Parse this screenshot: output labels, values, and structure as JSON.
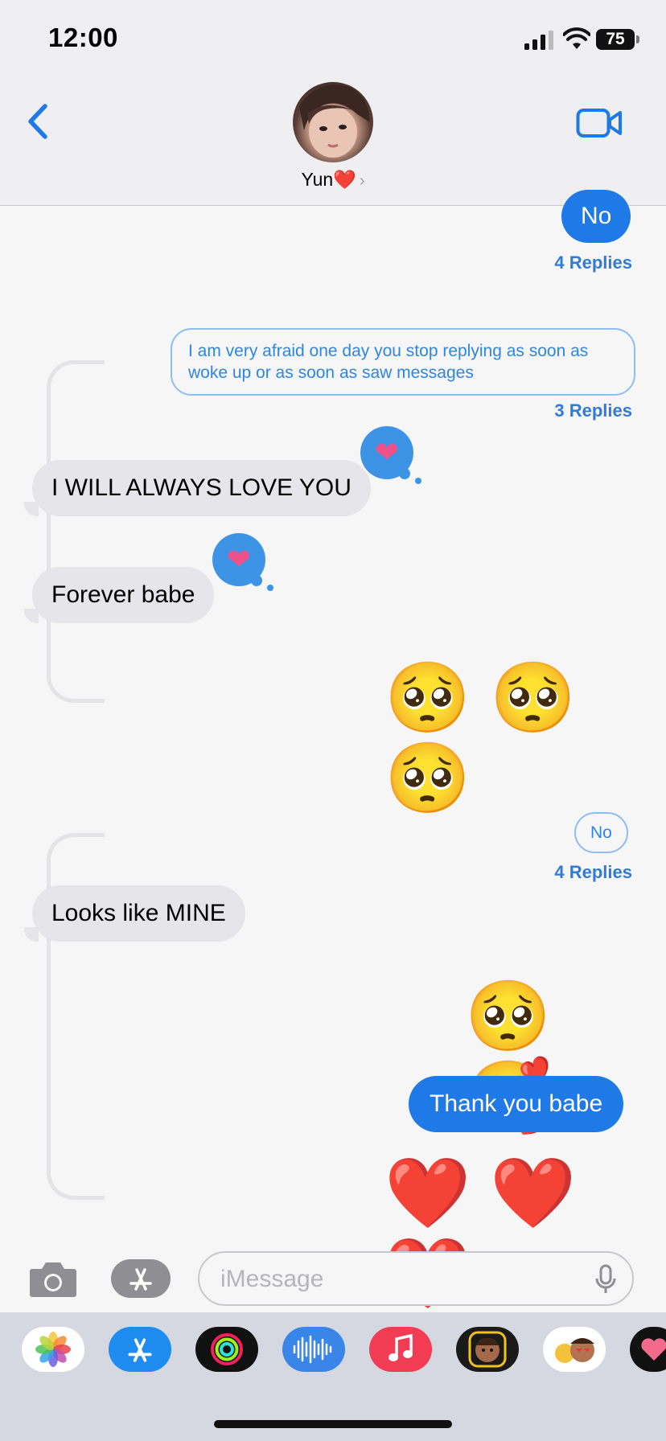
{
  "status_bar": {
    "time": "12:00",
    "battery": "75"
  },
  "header": {
    "contact_name": "Yun❤️",
    "chevron": "›"
  },
  "messages": {
    "top_partial": {
      "text": "No",
      "replies": "4 Replies"
    },
    "thread1_root": {
      "text": "I am very afraid one day you stop replying as soon as woke up or as soon as saw messages",
      "replies": "3 Replies"
    },
    "reply1": {
      "text": "I WILL ALWAYS LOVE YOU",
      "tapback": "❤"
    },
    "reply2": {
      "text": "Forever babe",
      "tapback": "❤"
    },
    "reply3_emojis": "🥺 🥺 🥺",
    "thread2_root": {
      "text": "No",
      "replies": "4 Replies"
    },
    "reply4": {
      "text": "Looks like MINE"
    },
    "reply5_emojis": "🥺 🥰",
    "reply6": {
      "text": "Thank you babe"
    },
    "reply7_emojis": "❤️ ❤️ ❤️"
  },
  "input": {
    "placeholder": "iMessage"
  },
  "colors": {
    "accent": "#1f7ae7",
    "bubble_gray": "#e5e5ea",
    "reply_link": "#2f7bd7"
  },
  "icons": {
    "back": "chevron-left-icon",
    "video": "video-camera-icon",
    "camera": "camera-icon",
    "apps": "app-store-icon",
    "mic": "microphone-icon"
  },
  "app_drawer": [
    "photos-app-icon",
    "app-store-app-icon",
    "activity-app-icon",
    "soundhound-app-icon",
    "music-app-icon",
    "memoji-app-icon",
    "animoji-app-icon",
    "digital-touch-app-icon"
  ]
}
